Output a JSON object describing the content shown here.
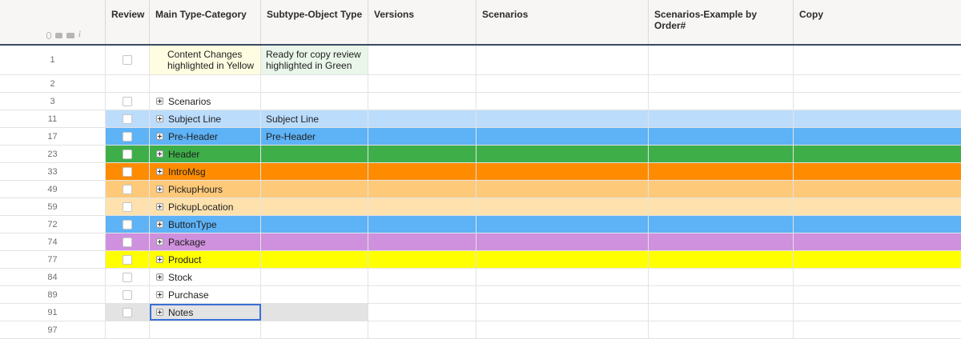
{
  "columns": {
    "review": "Review",
    "main_type": "Main Type-Category",
    "subtype": "Subtype-Object Type",
    "versions": "Versions",
    "scenarios": "Scenarios",
    "scenarios_example": "Scenarios-Example by Order#",
    "copy": "Copy"
  },
  "header_icons": [
    "attachment-icon",
    "comment-icon",
    "proof-icon",
    "info-icon"
  ],
  "rows": [
    {
      "num": "1",
      "main": "Content Changes highlighted in Yellow",
      "sub": "Ready for copy review highlighted in Green",
      "expand": false,
      "color": "#ffffff",
      "main_color": "#fffde1",
      "sub_color": "#e9f6e9",
      "checkbox": true
    },
    {
      "num": "2",
      "main": "",
      "sub": "",
      "expand": false,
      "color": "#ffffff",
      "checkbox": false
    },
    {
      "num": "3",
      "main": "Scenarios",
      "sub": "",
      "expand": true,
      "color": "#ffffff",
      "checkbox": true
    },
    {
      "num": "11",
      "main": "Subject Line",
      "sub": "Subject Line",
      "expand": true,
      "color": "#bcdcfc",
      "checkbox": true
    },
    {
      "num": "17",
      "main": "Pre-Header",
      "sub": "Pre-Header",
      "expand": true,
      "color": "#5eb2f6",
      "checkbox": true
    },
    {
      "num": "23",
      "main": "Header",
      "sub": "",
      "expand": true,
      "color": "#3eae49",
      "checkbox": true
    },
    {
      "num": "33",
      "main": "IntroMsg",
      "sub": "",
      "expand": true,
      "color": "#fe8b00",
      "checkbox": true
    },
    {
      "num": "49",
      "main": "PickupHours",
      "sub": "",
      "expand": true,
      "color": "#ffc97a",
      "checkbox": true
    },
    {
      "num": "59",
      "main": "PickupLocation",
      "sub": "",
      "expand": true,
      "color": "#ffe1ad",
      "checkbox": true
    },
    {
      "num": "72",
      "main": "ButtonType",
      "sub": "",
      "expand": true,
      "color": "#5eb2f6",
      "checkbox": true
    },
    {
      "num": "74",
      "main": "Package",
      "sub": "",
      "expand": true,
      "color": "#cf90dd",
      "checkbox": true
    },
    {
      "num": "77",
      "main": "Product",
      "sub": "",
      "expand": true,
      "color": "#ffff00",
      "checkbox": true
    },
    {
      "num": "84",
      "main": "Stock",
      "sub": "",
      "expand": true,
      "color": "#ffffff",
      "checkbox": true
    },
    {
      "num": "89",
      "main": "Purchase",
      "sub": "",
      "expand": true,
      "color": "#ffffff",
      "checkbox": true
    },
    {
      "num": "91",
      "main": "Notes",
      "sub": "",
      "expand": true,
      "color": "#e3e3e3",
      "checkbox": true,
      "selected": true
    },
    {
      "num": "97",
      "main": "",
      "sub": "",
      "expand": false,
      "color": "#ffffff",
      "checkbox": false
    }
  ]
}
